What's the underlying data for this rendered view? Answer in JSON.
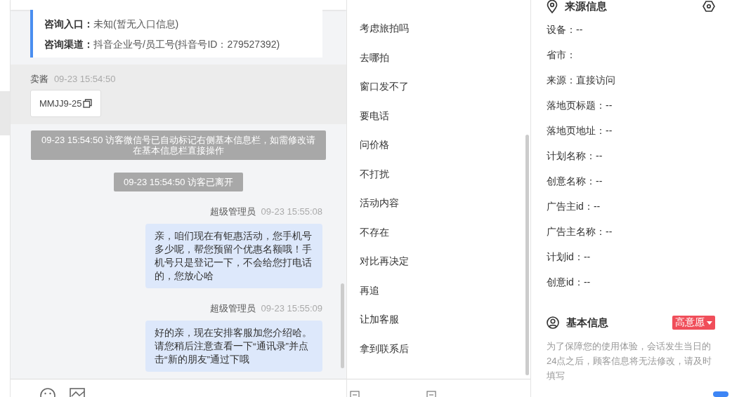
{
  "consult_card": {
    "rows": [
      {
        "label": "咨询入口：",
        "value": "未知(暂无入口信息)"
      },
      {
        "label": "咨询渠道：",
        "value": "抖音企业号/员工号(抖音号ID：279527392)"
      }
    ]
  },
  "messages": [
    {
      "kind": "visitor",
      "sender": "卖酱",
      "time": "09-23 15:54:50",
      "text": "MMJJ9-25"
    },
    {
      "kind": "system",
      "text": "09-23 15:54:50 访客微信号已自动标记右侧基本信息栏，如需修改请在基本信息栏直接操作"
    },
    {
      "kind": "system",
      "text": "09-23 15:54:50 访客已离开"
    },
    {
      "kind": "agent",
      "sender": "超级管理员",
      "time": "09-23 15:55:08",
      "text": "亲，咱们现在有钜惠活动，您手机号多少呢，帮您预留个优惠名额哦！手机号只是登记一下，不会给您打电话的，您放心哈"
    },
    {
      "kind": "agent",
      "sender": "超级管理员",
      "time": "09-23 15:55:09",
      "text": "好的亲，现在安排客服加您介绍哈。请您稍后注意查看一下“通讯录”并点击“新的朋友”通过下哦"
    }
  ],
  "quick_phrases": [
    "考虑旅拍吗",
    "去哪拍",
    "窗口发不了",
    "要电话",
    "问价格",
    "不打扰",
    "活动内容",
    "不存在",
    "对比再决定",
    "再追",
    "让加客服",
    "拿到联系后"
  ],
  "source_info": {
    "title": "来源信息",
    "fields": [
      "设备：--",
      "省市：",
      "来源：直接访问",
      "落地页标题：--",
      "落地页地址：--",
      "计划名称：--",
      "创意名称：--",
      "广告主id：--",
      "广告主名称：--",
      "计划id：--",
      "创意id：--"
    ]
  },
  "basic_info": {
    "title": "基本信息",
    "intent": "高意愿",
    "note": "为了保障您的使用体验，会话发生当日的24点之后，顾客信息将无法修改，请及时填写"
  }
}
